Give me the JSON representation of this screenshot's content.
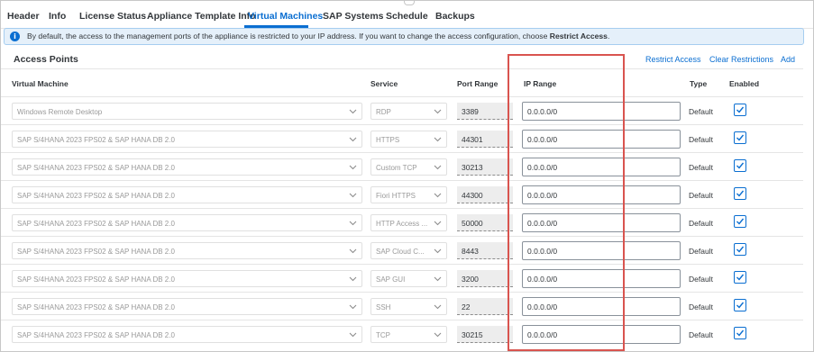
{
  "tabs": [
    {
      "label": "Header"
    },
    {
      "label": "Info"
    },
    {
      "label": "License Status"
    },
    {
      "label": "Appliance Template Info"
    },
    {
      "label": "Virtual Machines",
      "active": true
    },
    {
      "label": "SAP Systems"
    },
    {
      "label": "Schedule"
    },
    {
      "label": "Backups"
    }
  ],
  "info": {
    "icon": "info-icon",
    "text": "By default, the access to the management ports of the appliance is restricted to your IP address. If you want to change the access configuration, choose ",
    "emphasis": "Restrict Access",
    "suffix": "."
  },
  "access_points": {
    "title": "Access Points",
    "actions": {
      "restrict": "Restrict Access",
      "clear": "Clear Restrictions",
      "add": "Add"
    },
    "columns": {
      "vm": "Virtual Machine",
      "service": "Service",
      "port": "Port Range",
      "ip": "IP Range",
      "type": "Type",
      "enabled": "Enabled"
    },
    "rows": [
      {
        "vm": "Windows Remote Desktop",
        "service": "RDP",
        "port": "3389",
        "ip": "0.0.0.0/0",
        "type": "Default",
        "enabled": true
      },
      {
        "vm": "SAP S/4HANA 2023 FPS02 & SAP HANA DB 2.0",
        "service": "HTTPS",
        "port": "44301",
        "ip": "0.0.0.0/0",
        "type": "Default",
        "enabled": true
      },
      {
        "vm": "SAP S/4HANA 2023 FPS02 & SAP HANA DB 2.0",
        "service": "Custom TCP",
        "port": "30213",
        "ip": "0.0.0.0/0",
        "type": "Default",
        "enabled": true
      },
      {
        "vm": "SAP S/4HANA 2023 FPS02 & SAP HANA DB 2.0",
        "service": "Fiori HTTPS",
        "port": "44300",
        "ip": "0.0.0.0/0",
        "type": "Default",
        "enabled": true
      },
      {
        "vm": "SAP S/4HANA 2023 FPS02 & SAP HANA DB 2.0",
        "service": "HTTP Access ...",
        "port": "50000",
        "ip": "0.0.0.0/0",
        "type": "Default",
        "enabled": true
      },
      {
        "vm": "SAP S/4HANA 2023 FPS02 & SAP HANA DB 2.0",
        "service": "SAP Cloud C...",
        "port": "8443",
        "ip": "0.0.0.0/0",
        "type": "Default",
        "enabled": true
      },
      {
        "vm": "SAP S/4HANA 2023 FPS02 & SAP HANA DB 2.0",
        "service": "SAP GUI",
        "port": "3200",
        "ip": "0.0.0.0/0",
        "type": "Default",
        "enabled": true
      },
      {
        "vm": "SAP S/4HANA 2023 FPS02 & SAP HANA DB 2.0",
        "service": "SSH",
        "port": "22",
        "ip": "0.0.0.0/0",
        "type": "Default",
        "enabled": true
      },
      {
        "vm": "SAP S/4HANA 2023 FPS02 & SAP HANA DB 2.0",
        "service": "TCP",
        "port": "30215",
        "ip": "0.0.0.0/0",
        "type": "Default",
        "enabled": true
      }
    ]
  },
  "colors": {
    "accent": "#0a6ed1",
    "highlight": "#d9544f",
    "info_bg": "#e5f0fa"
  }
}
